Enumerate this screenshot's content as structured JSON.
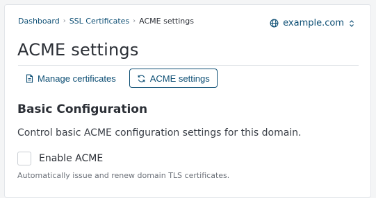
{
  "breadcrumb": {
    "items": [
      "Dashboard",
      "SSL Certificates",
      "ACME settings"
    ],
    "separator": ">"
  },
  "domain_selector": {
    "value": "example.com",
    "icon": "globe-icon",
    "indicator": "chevron-updown-icon"
  },
  "page": {
    "title": "ACME settings"
  },
  "tabs": [
    {
      "label": "Manage certificates",
      "icon": "document-icon",
      "active": false
    },
    {
      "label": "ACME settings",
      "icon": "refresh-icon",
      "active": true
    }
  ],
  "section": {
    "title": "Basic Configuration",
    "description": "Control basic ACME configuration settings for this domain."
  },
  "enable_acme": {
    "label": "Enable ACME",
    "checked": false,
    "help": "Automatically issue and renew domain TLS certificates."
  },
  "colors": {
    "link": "#0b4d73",
    "text": "#2b2f36",
    "border": "#e3e6ea"
  }
}
